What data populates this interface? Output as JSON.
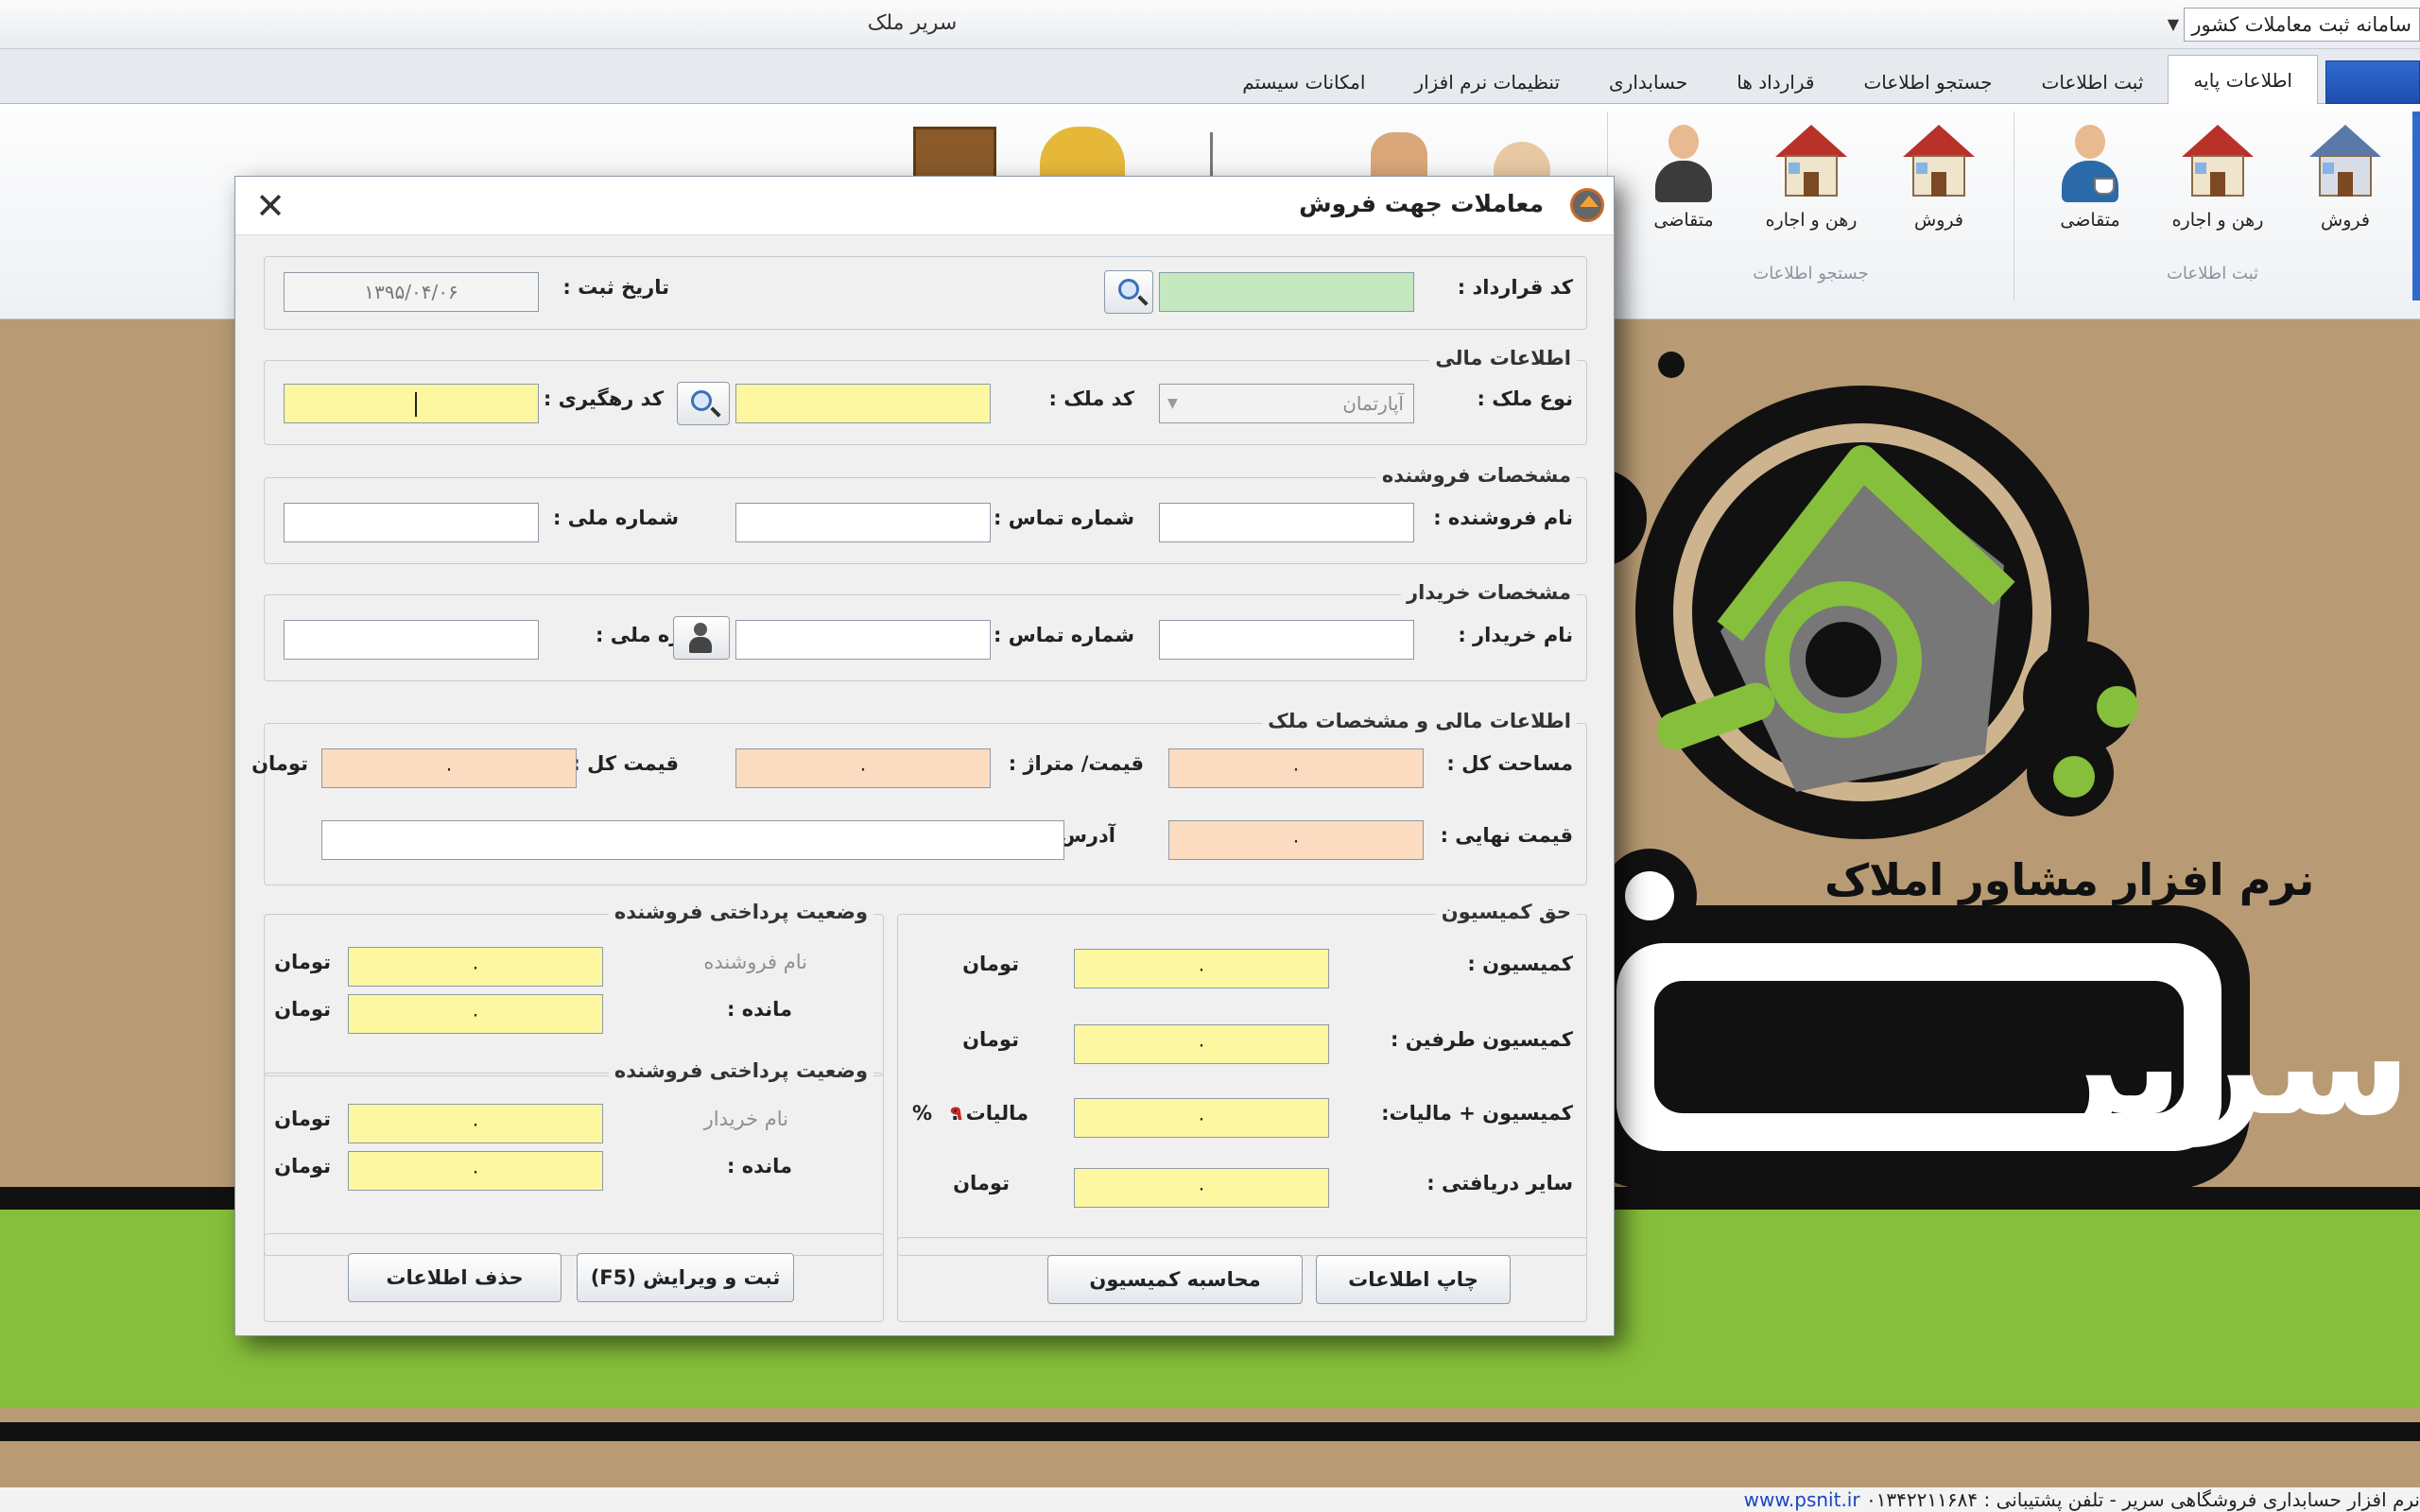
{
  "window": {
    "title": "سریر ملک",
    "quick_access_value": "سامانه ثبت معاملات کشور"
  },
  "tabs": [
    {
      "label": "اطلاعات پایه",
      "active": true
    },
    {
      "label": "ثبت اطلاعات"
    },
    {
      "label": "جستجو اطلاعات"
    },
    {
      "label": "قرارداد ها"
    },
    {
      "label": "حسابداری"
    },
    {
      "label": "تنظیمات نرم افزار"
    },
    {
      "label": "امکانات سیستم"
    }
  ],
  "ribbon": {
    "groups": [
      {
        "caption": "ثبت اطلاعات",
        "buttons": [
          {
            "label": "فروش",
            "icon": "house-blue-icon"
          },
          {
            "label": "رهن و اجاره",
            "icon": "house-icon"
          },
          {
            "label": "متقاضی",
            "icon": "person-coffee-icon"
          }
        ]
      },
      {
        "caption": "جستجو اطلاعات",
        "buttons": [
          {
            "label": "فروش",
            "icon": "house-fence-icon"
          },
          {
            "label": "رهن و اجاره",
            "icon": "house-icon"
          },
          {
            "label": "متقاضی",
            "icon": "person-binoculars-icon"
          }
        ]
      }
    ]
  },
  "background": {
    "tagline": "نرم افزار مشاور املاک",
    "brand": "سریر"
  },
  "status": {
    "text": "نرم افزار حسابداری فروشگاهی سریر - تلفن پشتیبانی : ۰۱۳۴۲۲۱۱۶۸۴",
    "url": "www.psnit.ir"
  },
  "dialog": {
    "title": "معاملات جهت فروش",
    "contract": {
      "code_label": "کد قرارداد :",
      "code_value": "",
      "date_label": "تاریخ ثبت :",
      "date_value": "۱۳۹۵/۰۴/۰۶"
    },
    "financial": {
      "title": "اطلاعات مالی",
      "type_label": "نوع ملک :",
      "type_value": "آپارتمان",
      "property_code_label": "کد ملک :",
      "property_code_value": "",
      "tracking_label": "کد رهگیری :",
      "tracking_value": ""
    },
    "seller": {
      "title": "مشخصات فروشنده",
      "name_label": "نام فروشنده :",
      "phone_label": "شماره تماس :",
      "national_label": "شماره ملی :"
    },
    "buyer": {
      "title": "مشخصات خریدار",
      "name_label": "نام خریدار :",
      "phone_label": "شماره تماس :",
      "national_label": "شماره ملی :"
    },
    "property": {
      "title": "اطلاعات مالی و مشخصات ملک",
      "area_label": "مساحت کل :",
      "area_value": "۰",
      "price_per_m_label": "قیمت/ متراژ :",
      "price_per_m_value": "۰",
      "total_label": "قیمت کل :",
      "total_value": "۰",
      "currency": "تومان",
      "final_label": "قیمت نهایی :",
      "final_value": "۰",
      "address_label": "آدرس :",
      "address_value": ""
    },
    "commission": {
      "title": "حق کمیسیون",
      "commission_label": "کمیسیون :",
      "commission_value": "۰",
      "both_label": "کمیسیون طرفین :",
      "both_value": "۰",
      "tax_label": "کمیسیون + مالیات:",
      "tax_value": "۰",
      "tax_rate_label": "مالیات :",
      "tax_rate_value": "۹",
      "percent": "%",
      "other_label": "سایر دریافتی :",
      "other_value": "۰",
      "currency": "تومان"
    },
    "seller_payment": {
      "title": "وضعیت پرداختی فروشنده",
      "name_label": "نام فروشنده",
      "name_value": "۰",
      "remaining_label": "مانده :",
      "remaining_value": "۰",
      "currency": "تومان"
    },
    "buyer_payment": {
      "title": "وضعیت پرداختی فروشنده",
      "name_label": "نام خریدار",
      "name_value": "۰",
      "remaining_label": "مانده :",
      "remaining_value": "۰",
      "currency": "تومان"
    },
    "buttons": {
      "print": "چاپ اطلاعات",
      "calc": "محاسبه کمیسیون",
      "save": "ثبت و ویرایش (F5)",
      "delete": "حذف اطلاعات"
    }
  }
}
